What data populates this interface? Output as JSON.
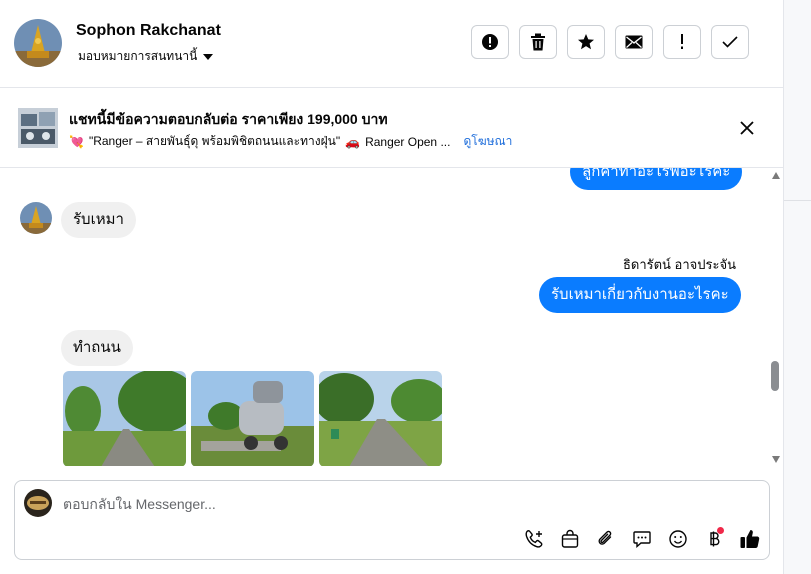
{
  "header": {
    "contact_name": "Sophon Rakchanat",
    "assigned_label": "มอบหมายการสนทนานี้",
    "actions": [
      "mark-spam",
      "delete",
      "star",
      "mark-unread",
      "report",
      "mark-done"
    ]
  },
  "ad": {
    "title": "แชทนี้มีข้อความตอบกลับต่อ ราคาเพียง 199,000 บาท",
    "description": "\"Ranger – สายพันธุ์ดุ พร้อมพิชิตถนนและทางฝุ่น\"",
    "description_tail": "Ranger Open ...",
    "link": "ดูโฆษณา"
  },
  "messages": {
    "outgoing_partial": "ลูกค้าทำอะไรพอะไรคะ",
    "incoming_1": "รับเหมา",
    "sender_name": "ธิดารัตน์ อาจประจัน",
    "outgoing_1": "รับเหมาเกี่ยวกับงานอะไรคะ",
    "incoming_2": "ทำถนน",
    "photos": [
      "road-photo-1",
      "cement-mixer-photo",
      "road-photo-2"
    ]
  },
  "composer": {
    "placeholder": "ตอบกลับใน Messenger...",
    "tools": [
      "add-call-icon",
      "shopping-bag-icon",
      "attachment-icon",
      "saved-reply-icon",
      "emoji-icon",
      "baht-payment-icon",
      "thumbs-up-icon"
    ]
  },
  "colors": {
    "accent": "#0a7cff",
    "link": "#216fdb",
    "notification_dot": "#f02849"
  }
}
